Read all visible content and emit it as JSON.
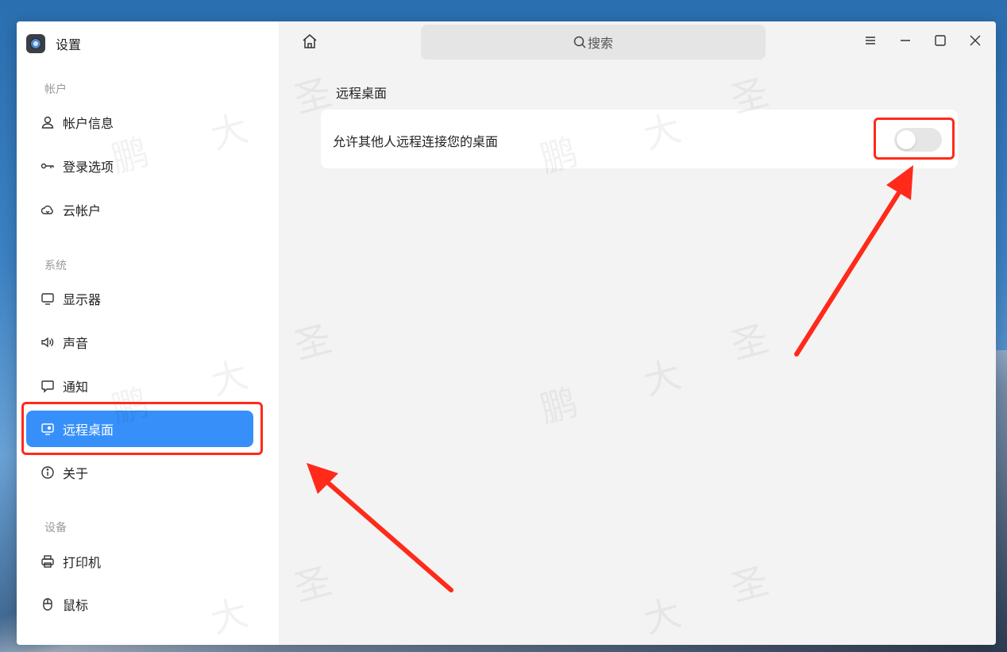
{
  "app": {
    "title": "设置"
  },
  "search": {
    "label": "搜索"
  },
  "sidebar": {
    "groups": [
      {
        "label": "帐户"
      },
      {
        "label": "系统"
      },
      {
        "label": "设备"
      }
    ],
    "items": [
      {
        "label": "帐户信息",
        "icon": "user-icon"
      },
      {
        "label": "登录选项",
        "icon": "key-icon"
      },
      {
        "label": "云帐户",
        "icon": "cloud-icon"
      },
      {
        "label": "显示器",
        "icon": "monitor-icon"
      },
      {
        "label": "声音",
        "icon": "speaker-icon"
      },
      {
        "label": "通知",
        "icon": "notification-icon"
      },
      {
        "label": "远程桌面",
        "icon": "remote-desktop-icon",
        "active": true
      },
      {
        "label": "关于",
        "icon": "info-icon"
      },
      {
        "label": "打印机",
        "icon": "printer-icon"
      },
      {
        "label": "鼠标",
        "icon": "mouse-icon"
      }
    ]
  },
  "main": {
    "section_title": "远程桌面",
    "setting": {
      "label": "允许其他人远程连接您的桌面",
      "toggle_on": false
    }
  },
  "watermark": [
    "圣",
    "大",
    "鹏"
  ],
  "colors": {
    "accent": "#3790fa",
    "annotation": "#ff2a1a"
  }
}
